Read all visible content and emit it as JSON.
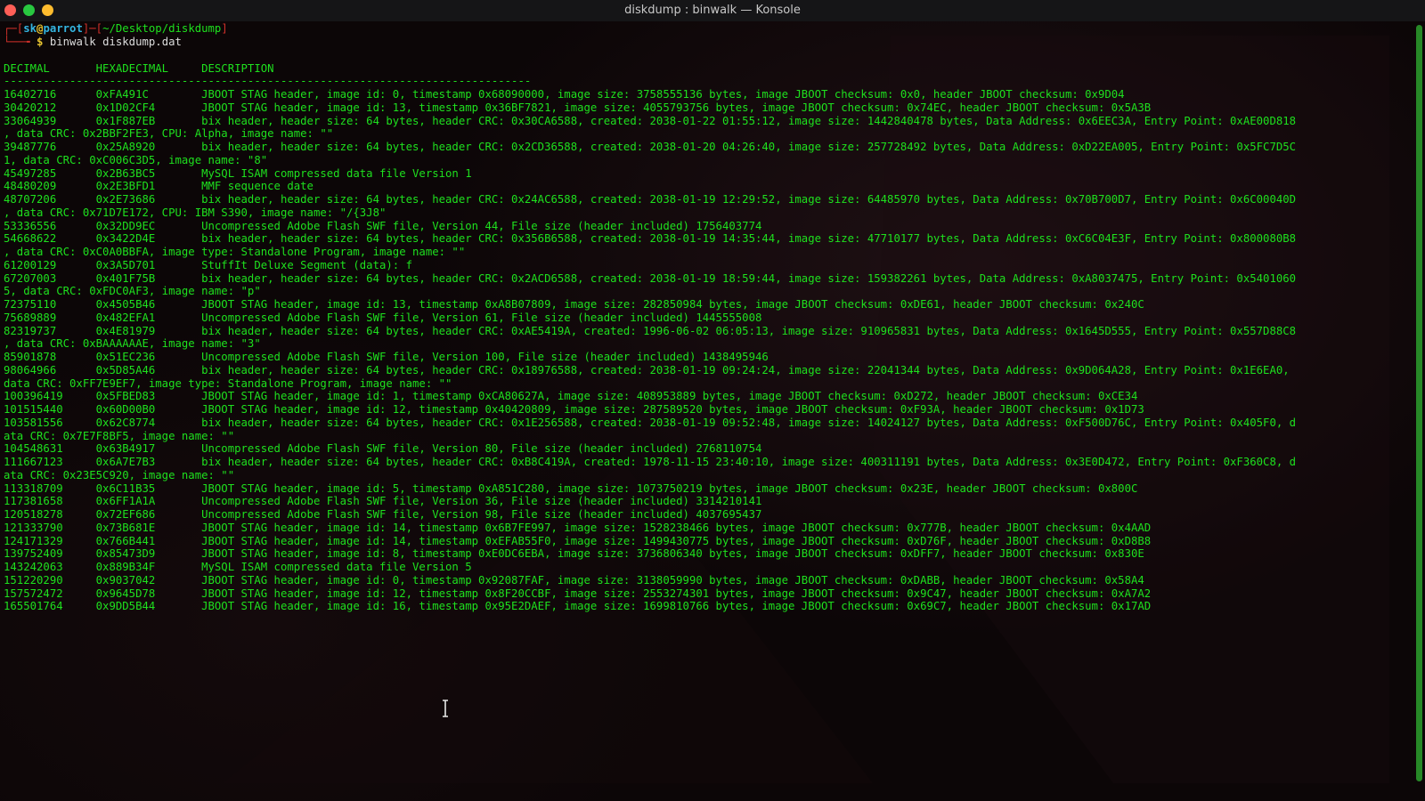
{
  "window": {
    "title": "diskdump : binwalk — Konsole"
  },
  "prompt": {
    "open": "┌─[",
    "user": "sk",
    "at": "@",
    "host": "parrot",
    "sep": "]─[",
    "path": "~/Desktop/diskdump",
    "close": "]",
    "arrow": "└──╼ ",
    "dollar": "$",
    "command": " binwalk diskdump.dat"
  },
  "table": {
    "header": "DECIMAL       HEXADECIMAL     DESCRIPTION",
    "separator": "--------------------------------------------------------------------------------",
    "lines": [
      "16402716      0xFA491C        JBOOT STAG header, image id: 0, timestamp 0x68090000, image size: 3758555136 bytes, image JBOOT checksum: 0x0, header JBOOT checksum: 0x9D04",
      "30420212      0x1D02CF4       JBOOT STAG header, image id: 13, timestamp 0x36BF7821, image size: 4055793756 bytes, image JBOOT checksum: 0x74EC, header JBOOT checksum: 0x5A3B",
      "33064939      0x1F887EB       bix header, header size: 64 bytes, header CRC: 0x30CA6588, created: 2038-01-22 01:55:12, image size: 1442840478 bytes, Data Address: 0x6EEC3A, Entry Point: 0xAE00D818",
      ", data CRC: 0x2BBF2FE3, CPU: Alpha, image name: \"\"",
      "39487776      0x25A8920       bix header, header size: 64 bytes, header CRC: 0x2CD36588, created: 2038-01-20 04:26:40, image size: 257728492 bytes, Data Address: 0xD22EA005, Entry Point: 0x5FC7D5C",
      "1, data CRC: 0xC006C3D5, image name: \"8\"",
      "45497285      0x2B63BC5       MySQL ISAM compressed data file Version 1",
      "48480209      0x2E3BFD1       MMF sequence date",
      "48707206      0x2E73686       bix header, header size: 64 bytes, header CRC: 0x24AC6588, created: 2038-01-19 12:29:52, image size: 64485970 bytes, Data Address: 0x70B700D7, Entry Point: 0x6C00040D",
      ", data CRC: 0x71D7E172, CPU: IBM S390, image name: \"/{3J8\"",
      "53336556      0x32DD9EC       Uncompressed Adobe Flash SWF file, Version 44, File size (header included) 1756403774",
      "54668622      0x3422D4E       bix header, header size: 64 bytes, header CRC: 0x356B6588, created: 2038-01-19 14:35:44, image size: 47710177 bytes, Data Address: 0xC6C04E3F, Entry Point: 0x800080B8",
      ", data CRC: 0xC0A0BBFA, image type: Standalone Program, image name: \"\"",
      "61200129      0x3A5D701       StuffIt Deluxe Segment (data): f",
      "67207003      0x401F75B       bix header, header size: 64 bytes, header CRC: 0x2ACD6588, created: 2038-01-19 18:59:44, image size: 159382261 bytes, Data Address: 0xA8037475, Entry Point: 0x5401060",
      "5, data CRC: 0xFDC0AF3, image name: \"p\"",
      "72375110      0x4505B46       JBOOT STAG header, image id: 13, timestamp 0xA8B07809, image size: 282850984 bytes, image JBOOT checksum: 0xDE61, header JBOOT checksum: 0x240C",
      "75689889      0x482EFA1       Uncompressed Adobe Flash SWF file, Version 61, File size (header included) 1445555008",
      "82319737      0x4E81979       bix header, header size: 64 bytes, header CRC: 0xAE5419A, created: 1996-06-02 06:05:13, image size: 910965831 bytes, Data Address: 0x1645D555, Entry Point: 0x557D88C8",
      ", data CRC: 0xBAAAAAAE, image name: \"3\"",
      "85901878      0x51EC236       Uncompressed Adobe Flash SWF file, Version 100, File size (header included) 1438495946",
      "98064966      0x5D85A46       bix header, header size: 64 bytes, header CRC: 0x18976588, created: 2038-01-19 09:24:24, image size: 22041344 bytes, Data Address: 0x9D064A28, Entry Point: 0x1E6EA0,",
      "data CRC: 0xFF7E9EF7, image type: Standalone Program, image name: \"\"",
      "100396419     0x5FBED83       JBOOT STAG header, image id: 1, timestamp 0xCA80627A, image size: 408953889 bytes, image JBOOT checksum: 0xD272, header JBOOT checksum: 0xCE34",
      "101515440     0x60D00B0       JBOOT STAG header, image id: 12, timestamp 0x40420809, image size: 287589520 bytes, image JBOOT checksum: 0xF93A, header JBOOT checksum: 0x1D73",
      "103581556     0x62C8774       bix header, header size: 64 bytes, header CRC: 0x1E256588, created: 2038-01-19 09:52:48, image size: 14024127 bytes, Data Address: 0xF500D76C, Entry Point: 0x405F0, d",
      "ata CRC: 0x7E7F8BF5, image name: \"\"",
      "104548631     0x63B4917       Uncompressed Adobe Flash SWF file, Version 80, File size (header included) 2768110754",
      "111667123     0x6A7E7B3       bix header, header size: 64 bytes, header CRC: 0xB8C419A, created: 1978-11-15 23:40:10, image size: 400311191 bytes, Data Address: 0x3E0D472, Entry Point: 0xF360C8, d",
      "ata CRC: 0x23E5C920, image name: \"\"",
      "113318709     0x6C11B35       JBOOT STAG header, image id: 5, timestamp 0xA851C280, image size: 1073750219 bytes, image JBOOT checksum: 0x23E, header JBOOT checksum: 0x800C",
      "117381658     0x6FF1A1A       Uncompressed Adobe Flash SWF file, Version 36, File size (header included) 3314210141",
      "120518278     0x72EF686       Uncompressed Adobe Flash SWF file, Version 98, File size (header included) 4037695437",
      "121333790     0x73B681E       JBOOT STAG header, image id: 14, timestamp 0x6B7FE997, image size: 1528238466 bytes, image JBOOT checksum: 0x777B, header JBOOT checksum: 0x4AAD",
      "124171329     0x766B441       JBOOT STAG header, image id: 14, timestamp 0xEFAB55F0, image size: 1499430775 bytes, image JBOOT checksum: 0xD76F, header JBOOT checksum: 0xD8B8",
      "139752409     0x85473D9       JBOOT STAG header, image id: 8, timestamp 0xE0DC6EBA, image size: 3736806340 bytes, image JBOOT checksum: 0xDFF7, header JBOOT checksum: 0x830E",
      "143242063     0x889B34F       MySQL ISAM compressed data file Version 5",
      "151220290     0x9037042       JBOOT STAG header, image id: 0, timestamp 0x92087FAF, image size: 3138059990 bytes, image JBOOT checksum: 0xDABB, header JBOOT checksum: 0x58A4",
      "157572472     0x9645D78       JBOOT STAG header, image id: 12, timestamp 0x8F20CCBF, image size: 2553274301 bytes, image JBOOT checksum: 0x9C47, header JBOOT checksum: 0xA7A2",
      "165501764     0x9DD5B44       JBOOT STAG header, image id: 16, timestamp 0x95E2DAEF, image size: 1699810766 bytes, image JBOOT checksum: 0x69C7, header JBOOT checksum: 0x17AD"
    ]
  }
}
